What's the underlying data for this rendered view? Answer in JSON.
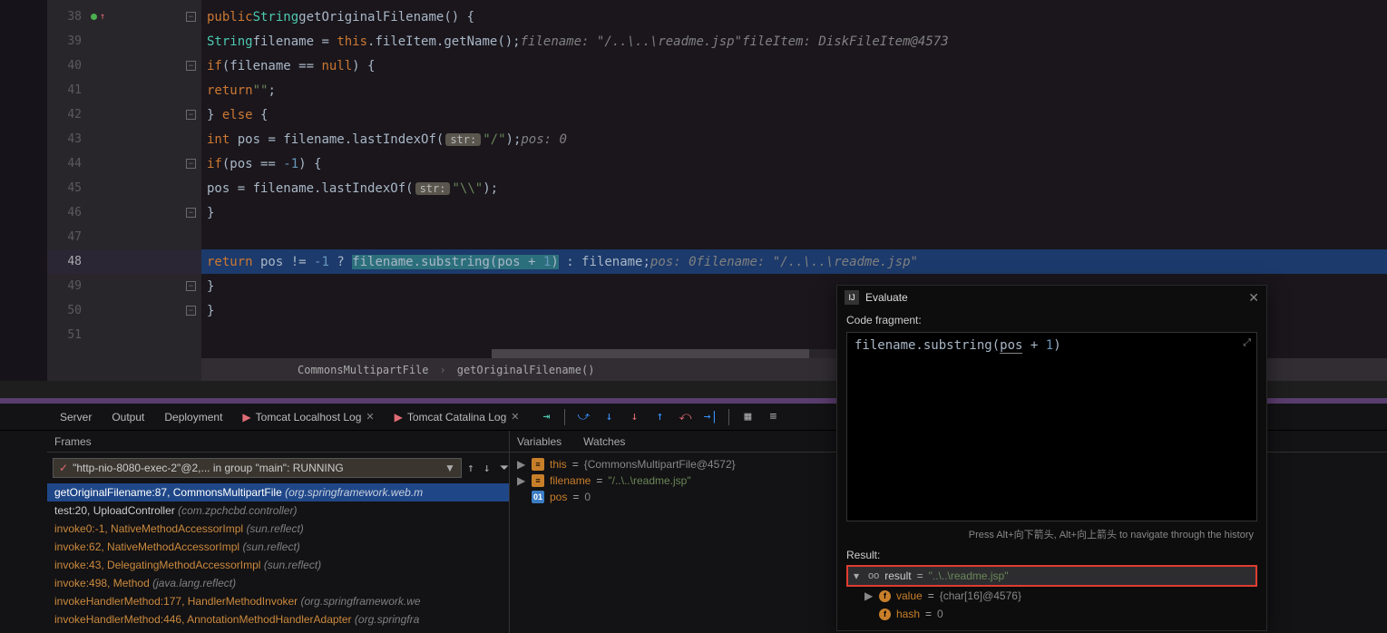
{
  "editor": {
    "lines": [
      {
        "n": 38,
        "ind": [
          "green-dot",
          "arrow-up"
        ]
      },
      {
        "n": 39
      },
      {
        "n": 40
      },
      {
        "n": 41
      },
      {
        "n": 42
      },
      {
        "n": 43
      },
      {
        "n": 44
      },
      {
        "n": 45
      },
      {
        "n": 46
      },
      {
        "n": 47
      },
      {
        "n": 48,
        "current": true
      },
      {
        "n": 49
      },
      {
        "n": 50
      },
      {
        "n": 51
      }
    ],
    "code": {
      "l38": {
        "kw1": "public",
        "type": "String",
        "method": "getOriginalFilename",
        "paren": "() {"
      },
      "l39": {
        "type": "String",
        "var": "filename",
        "eq": " = ",
        "kw": "this",
        "chain": ".fileItem.getName();",
        "c1": "filename: \"/..\\..\\readme.jsp\"",
        "c2": "fileItem: DiskFileItem@4573"
      },
      "l40": {
        "kw": "if",
        "cond": "(filename == ",
        "kw2": "null",
        "close": ") {"
      },
      "l41": {
        "kw": "return",
        "str": "\"\"",
        "semi": ";"
      },
      "l42": {
        "close": "} ",
        "kw": "else",
        "open": " {"
      },
      "l43": {
        "kw": "int",
        "var": " pos = filename.lastIndexOf(",
        "hint": "str:",
        "str": "\"/\"",
        "close": ");",
        "c": "pos: 0"
      },
      "l44": {
        "kw": "if",
        "cond": "(pos == ",
        "num": "-1",
        "close": ") {"
      },
      "l45": {
        "body": "pos = filename.lastIndexOf(",
        "hint": "str:",
        "str": "\"\\\\\"",
        "close": ");"
      },
      "l46": {
        "close": "}"
      },
      "l48": {
        "kw": "return",
        "cond": " pos != ",
        "num": "-1",
        "tern": " ? ",
        "sel": "filename.substring(pos + ",
        "selnum": "1",
        "selclose": ")",
        "rest": " : filename;",
        "c1": "pos: 0",
        "c2": "filename: \"/..\\..\\readme.jsp\""
      },
      "l49": {
        "close": "}"
      },
      "l50": {
        "close": "}"
      }
    }
  },
  "breadcrumb": {
    "a": "CommonsMultipartFile",
    "b": "getOriginalFilename()"
  },
  "debug": {
    "tabs": {
      "server": "Server",
      "output": "Output",
      "deployment": "Deployment",
      "tomcat_localhost": "Tomcat Localhost Log",
      "tomcat_catalina": "Tomcat Catalina Log"
    },
    "frames_label": "Frames",
    "variables_label": "Variables",
    "watches_label": "Watches",
    "thread": "\"http-nio-8080-exec-2\"@2,... in group \"main\": RUNNING",
    "frames": [
      {
        "txt": "getOriginalFilename:87, CommonsMultipartFile",
        "pkg": "(org.springframework.web.m",
        "sel": true
      },
      {
        "txt": "test:20, UploadController",
        "pkg": "(com.zpchcbd.controller)",
        "white": true
      },
      {
        "txt": "invoke0:-1, NativeMethodAccessorImpl",
        "pkg": "(sun.reflect)"
      },
      {
        "txt": "invoke:62, NativeMethodAccessorImpl",
        "pkg": "(sun.reflect)"
      },
      {
        "txt": "invoke:43, DelegatingMethodAccessorImpl",
        "pkg": "(sun.reflect)"
      },
      {
        "txt": "invoke:498, Method",
        "pkg": "(java.lang.reflect)"
      },
      {
        "txt": "invokeHandlerMethod:177, HandlerMethodInvoker",
        "pkg": "(org.springframework.we"
      },
      {
        "txt": "invokeHandlerMethod:446, AnnotationMethodHandlerAdapter",
        "pkg": "(org.springfra"
      }
    ],
    "vars": [
      {
        "icon": "obj",
        "name": "this",
        "val": "{CommonsMultipartFile@4572}"
      },
      {
        "icon": "obj",
        "name": "filename",
        "val": "\"/..\\..\\readme.jsp\"",
        "str": true
      },
      {
        "icon": "int",
        "name": "pos",
        "val": "0"
      }
    ]
  },
  "evaluate": {
    "title": "Evaluate",
    "label": "Code fragment:",
    "input_pre": "filename.substring(",
    "input_u": "pos",
    "input_post": " + ",
    "input_num": "1",
    "input_close": ")",
    "hint": "Press Alt+向下箭头, Alt+向上箭头 to navigate through the history",
    "result_label": "Result:",
    "result_name": "result",
    "result_val": "\"..\\..\\readme.jsp\"",
    "value_name": "value",
    "value_val": "{char[16]@4576}",
    "hash_name": "hash",
    "hash_val": "0"
  }
}
